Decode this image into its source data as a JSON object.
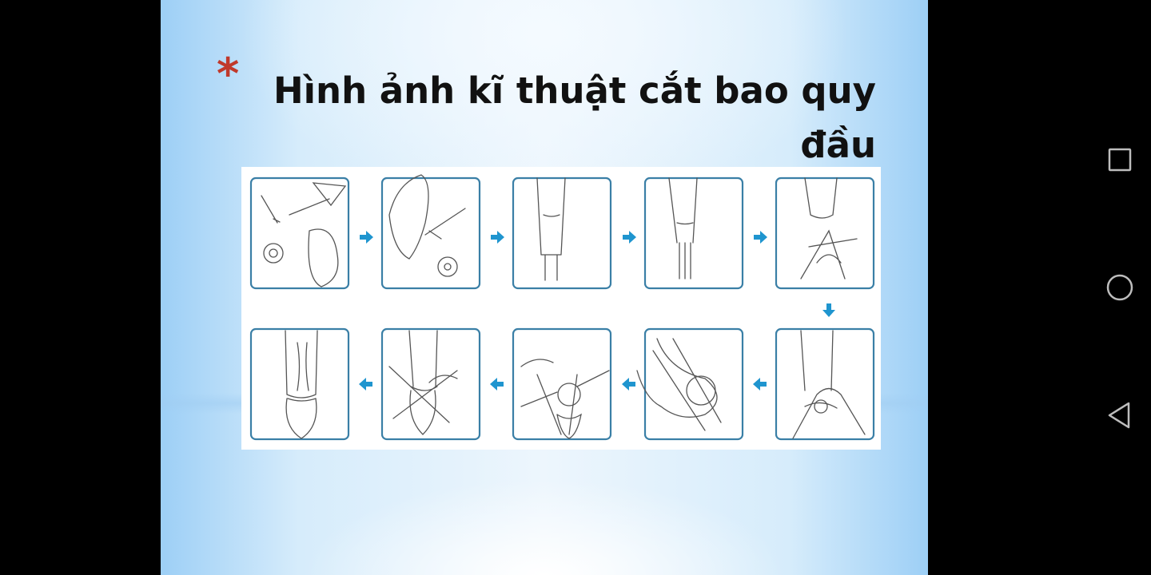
{
  "slide": {
    "bullet": "*",
    "title": "Hình ảnh kĩ thuật cắt bao quy đầu",
    "figure": {
      "description_icons": "circumcision-procedure-steps",
      "accent_color": "#1f95cf",
      "frame_color": "#3a7fa6",
      "steps": 10
    }
  },
  "navbar": {
    "recent_icon": "square-icon",
    "home_icon": "circle-icon",
    "back_icon": "triangle-back-icon"
  }
}
